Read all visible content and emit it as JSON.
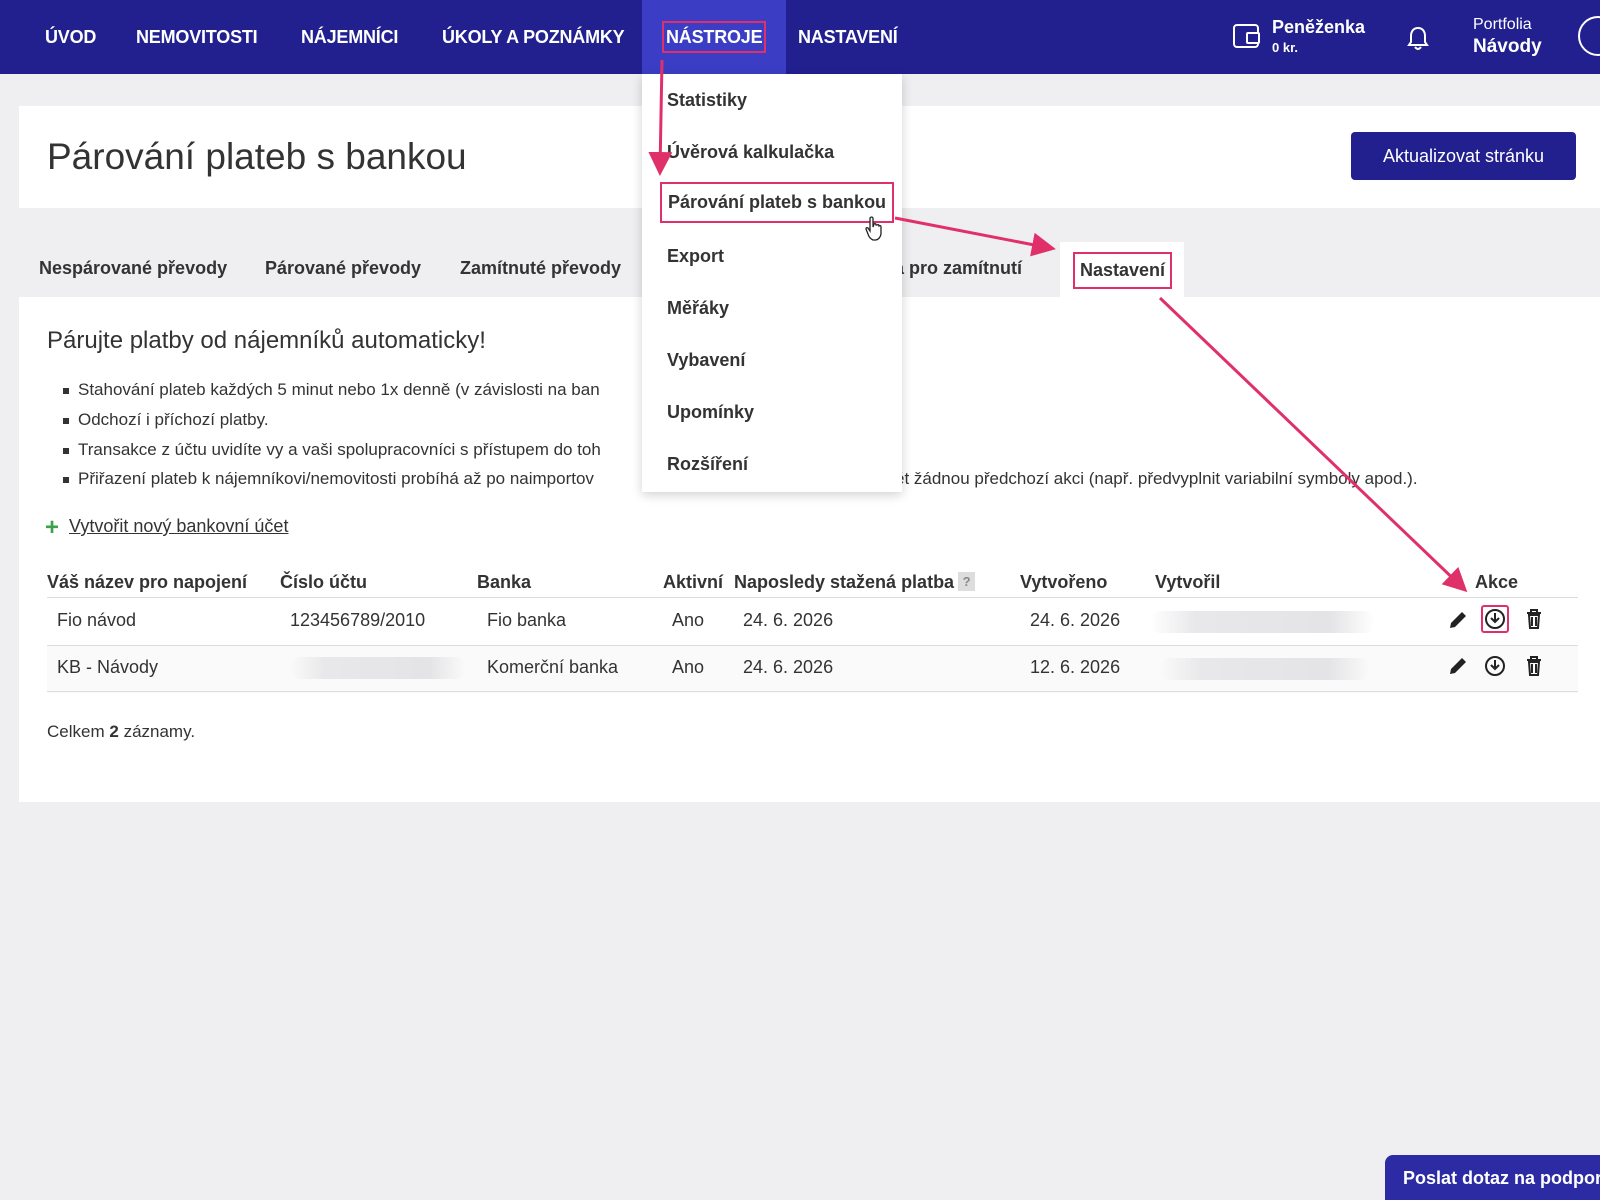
{
  "nav": {
    "items": [
      "ÚVOD",
      "NEMOVITOSTI",
      "NÁJEMNÍCI",
      "ÚKOLY A POZNÁMKY",
      "NÁSTROJE",
      "NASTAVENÍ"
    ],
    "wallet_title": "Peněženka",
    "wallet_amount": "0 kr.",
    "portfolio_label": "Portfolia",
    "portfolio_name": "Návody",
    "icons": [
      "wallet-icon",
      "bell-icon",
      "user-avatar-icon"
    ]
  },
  "header": {
    "title": "Párování plateb s bankou",
    "refresh_label": "Aktualizovat stránku"
  },
  "tabs": [
    "Nespárované převody",
    "Párované převody",
    "Zamítnuté převody",
    "la pro zamítnutí",
    "Nastavení"
  ],
  "dropdown": {
    "items": [
      "Statistiky",
      "Úvěrová kalkulačka",
      "Párování plateb s bankou",
      "Export",
      "Měřáky",
      "Vybavení",
      "Upomínky",
      "Rozšíření"
    ]
  },
  "content": {
    "title": "Párujte platby od nájemníků automaticky!",
    "bullets": [
      "Stahování plateb každých 5 minut nebo 1x denně (v závislosti na ban",
      "Odchozí i příchozí platby.",
      "Transakce z účtu uvidíte vy a vaši spolupracovníci s přístupem do toh",
      "Přiřazení plateb k nájemníkovi/nemovitosti probíhá až po naimportov",
      "ět žádnou předchozí akci (např. předvyplnit variabilní symboly apod.)."
    ],
    "create_link": "Vytvořit nový bankovní účet"
  },
  "table": {
    "columns": [
      "Váš název pro napojení",
      "Číslo účtu",
      "Banka",
      "Aktivní",
      "Naposledy stažená platba",
      "Vytvořeno",
      "Vytvořil",
      "Akce"
    ],
    "help_mark": "?",
    "rows": [
      {
        "name": "Fio návod",
        "account": "123456789/2010",
        "bank": "Fio banka",
        "active": "Ano",
        "last": "24. 6. 2026",
        "created": "24. 6. 2026"
      },
      {
        "name": "KB - Návody",
        "account": "",
        "bank": "Komerční banka",
        "active": "Ano",
        "last": "24. 6. 2026",
        "created": "12. 6. 2026"
      }
    ],
    "action_icons": [
      "pencil-icon",
      "download-icon",
      "trash-icon"
    ]
  },
  "footer": {
    "total_prefix": "Celkem",
    "total_count": "2",
    "total_suffix": "záznamy."
  },
  "support_label": "Poslat dotaz na podporu",
  "colors": {
    "nav": "#22208f",
    "active_nav": "#3b3ec4",
    "highlight": "#e0306a",
    "plus": "#3aa24b"
  }
}
